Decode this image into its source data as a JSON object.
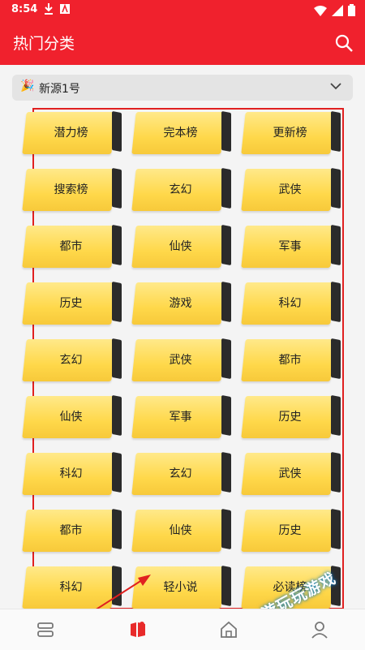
{
  "status_bar": {
    "time": "8:54"
  },
  "app_bar": {
    "title": "热门分类"
  },
  "source_selector": {
    "emoji": "🎉",
    "label": "新源1号"
  },
  "categories": [
    [
      "潜力榜",
      "完本榜",
      "更新榜"
    ],
    [
      "搜索榜",
      "玄幻",
      "武侠"
    ],
    [
      "都市",
      "仙侠",
      "军事"
    ],
    [
      "历史",
      "游戏",
      "科幻"
    ],
    [
      "玄幻",
      "武侠",
      "都市"
    ],
    [
      "仙侠",
      "军事",
      "历史"
    ],
    [
      "科幻",
      "玄幻",
      "武侠"
    ],
    [
      "都市",
      "仙侠",
      "历史"
    ],
    [
      "科幻",
      "轻小说",
      "必读榜"
    ]
  ],
  "bottom_nav": [
    "bookshelf",
    "discover",
    "home",
    "profile"
  ],
  "watermark": "游玩玩游戏",
  "colors": {
    "accent": "#f0212d",
    "card": "#ffd84a"
  }
}
